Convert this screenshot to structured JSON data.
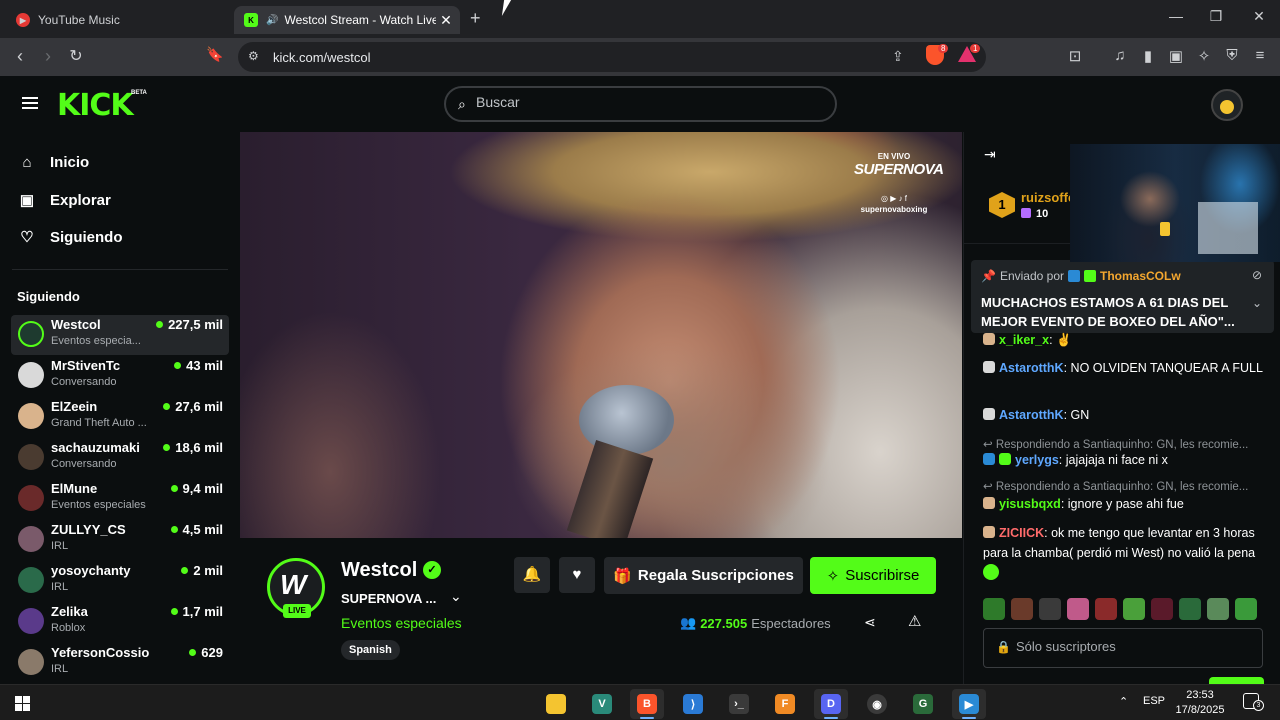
{
  "browser": {
    "tabs": [
      {
        "title": "YouTube Music",
        "active": false
      },
      {
        "title": "Westcol Stream - Watch Live on Kick",
        "active": true
      }
    ],
    "url": "kick.com/westcol",
    "shield_badge": "8",
    "rewards_badge": "1"
  },
  "header": {
    "logo": "KICK",
    "beta": "BETA",
    "search_placeholder": "Buscar"
  },
  "sidebar": {
    "nav": [
      {
        "label": "Inicio",
        "icon": "home-icon"
      },
      {
        "label": "Explorar",
        "icon": "compass-icon"
      },
      {
        "label": "Siguiendo",
        "icon": "heart-icon"
      }
    ],
    "following_title": "Siguiendo",
    "channels": [
      {
        "name": "Westcol",
        "category": "Eventos especia...",
        "viewers": "227,5 mil",
        "color": "#1e3a2f"
      },
      {
        "name": "MrStivenTc",
        "category": "Conversando",
        "viewers": "43 mil",
        "color": "#d9d9d9"
      },
      {
        "name": "ElZeein",
        "category": "Grand Theft Auto ...",
        "viewers": "27,6 mil",
        "color": "#d9b38c"
      },
      {
        "name": "sachauzumaki",
        "category": "Conversando",
        "viewers": "18,6 mil",
        "color": "#4a3b30"
      },
      {
        "name": "ElMune",
        "category": "Eventos especiales",
        "viewers": "9,4 mil",
        "color": "#6a2a2a"
      },
      {
        "name": "ZULLYY_CS",
        "category": "IRL",
        "viewers": "4,5 mil",
        "color": "#7a5a6a"
      },
      {
        "name": "yosoychanty",
        "category": "IRL",
        "viewers": "2 mil",
        "color": "#2a6a4a"
      },
      {
        "name": "Zelika",
        "category": "Roblox",
        "viewers": "1,7 mil",
        "color": "#5a3a8a"
      },
      {
        "name": "YefersonCossio",
        "category": "IRL",
        "viewers": "629",
        "color": "#8a7a6a"
      }
    ]
  },
  "video_overlay": {
    "line1": "EN VIVO",
    "line2": "SUPERNOVA",
    "line3": "supernovaboxing"
  },
  "stream": {
    "streamer": "Westcol",
    "live_label": "LIVE",
    "title": "SUPERNOVA ...",
    "category": "Eventos especiales",
    "tag": "Spanish",
    "gift_label": "Regala Suscripciones",
    "subscribe_label": "Suscribirse",
    "viewer_count": "227.505",
    "viewer_label": "Espectadores"
  },
  "chat": {
    "leader": {
      "rank": "1",
      "name": "ruizsoffe",
      "count": "10"
    },
    "pinned": {
      "by_label": "Enviado por",
      "user": "ThomasCOLw",
      "message": "MUCHACHOS ESTAMOS A 61 DIAS DEL MEJOR EVENTO DE BOXEO DEL AÑO\"..."
    },
    "messages": [
      {
        "user": "x_iker_x",
        "text": "",
        "color": "#53fc18"
      },
      {
        "user": "AstarotthK",
        "text": "NO OLVIDEN TANQUEAR A FULL",
        "color": "#5fa8ff"
      },
      {
        "user": "AstarotthK",
        "text": "GN",
        "color": "#5fa8ff"
      },
      {
        "reply": "Respondiendo a Santiaquinho: GN, les recomie...",
        "user": "yerlygs",
        "text": "jajajaja ni face ni x",
        "color": "#5fa8ff"
      },
      {
        "reply": "Respondiendo a Santiaquinho: GN, les recomie...",
        "user": "yisusbqxd",
        "text": "ignore y pase ahi fue",
        "color": "#53fc18"
      },
      {
        "user": "ZICIICK",
        "text": "ok me tengo que levantar en 3 horas para la chamba( perdió mi West) no valió la pena",
        "color": "#ff6b6b"
      }
    ],
    "input_placeholder": "Sólo suscriptores"
  },
  "taskbar": {
    "lang": "ESP",
    "time": "23:53",
    "date": "17/8/2025",
    "notifications": "3",
    "apps": [
      {
        "name": "file-explorer",
        "color": "#f4c430"
      },
      {
        "name": "veracrypt",
        "color": "#2a8a7a"
      },
      {
        "name": "brave",
        "color": "#fb542b"
      },
      {
        "name": "vscode",
        "color": "#2a7ad5"
      },
      {
        "name": "terminal",
        "color": "#3a3a3a"
      },
      {
        "name": "fl-studio",
        "color": "#f08a24"
      },
      {
        "name": "discord",
        "color": "#5865f2"
      },
      {
        "name": "obs",
        "color": "#3a3a3a"
      },
      {
        "name": "logitech",
        "color": "#2a6a3a"
      },
      {
        "name": "media",
        "color": "#2a8ad5"
      }
    ]
  },
  "colors": {
    "accent": "#53fc18",
    "bg": "#0b0e0f",
    "panel": "#24272a"
  }
}
